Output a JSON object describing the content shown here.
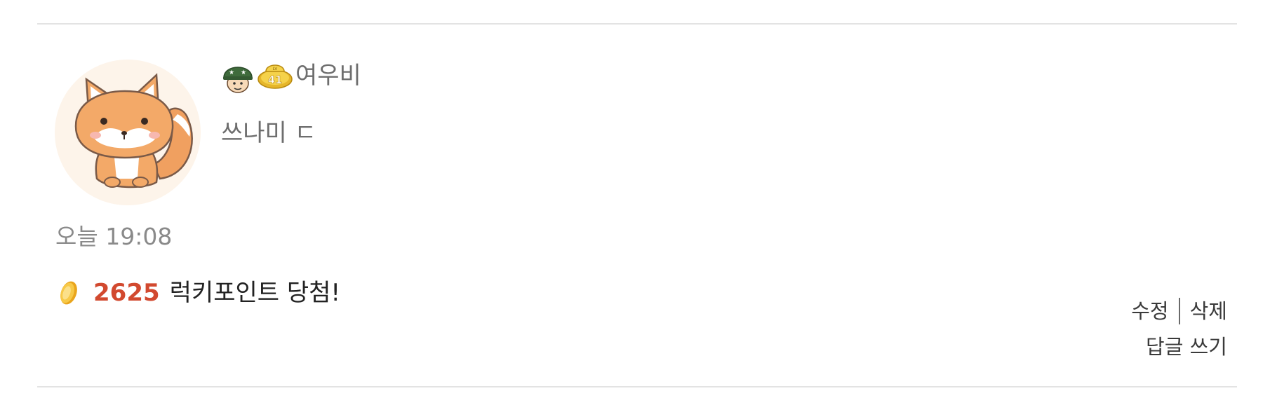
{
  "comment": {
    "author": {
      "name": "여우비",
      "level": "41",
      "level_prefix": "LV"
    },
    "text": "쓰나미 ㄷ",
    "timestamp": "오늘 19:08",
    "lucky": {
      "points": "2625",
      "message": "럭키포인트 당첨!"
    },
    "actions": {
      "edit": "수정",
      "delete": "삭제",
      "reply": "답글 쓰기"
    },
    "icons": {
      "avatar": "fox-avatar",
      "rank_badge": "soldier-helmet-icon",
      "level_badge": "level-badge-icon",
      "coin": "coin-icon"
    },
    "colors": {
      "points": "#d2492f",
      "divider": "#e3e3e3"
    }
  }
}
